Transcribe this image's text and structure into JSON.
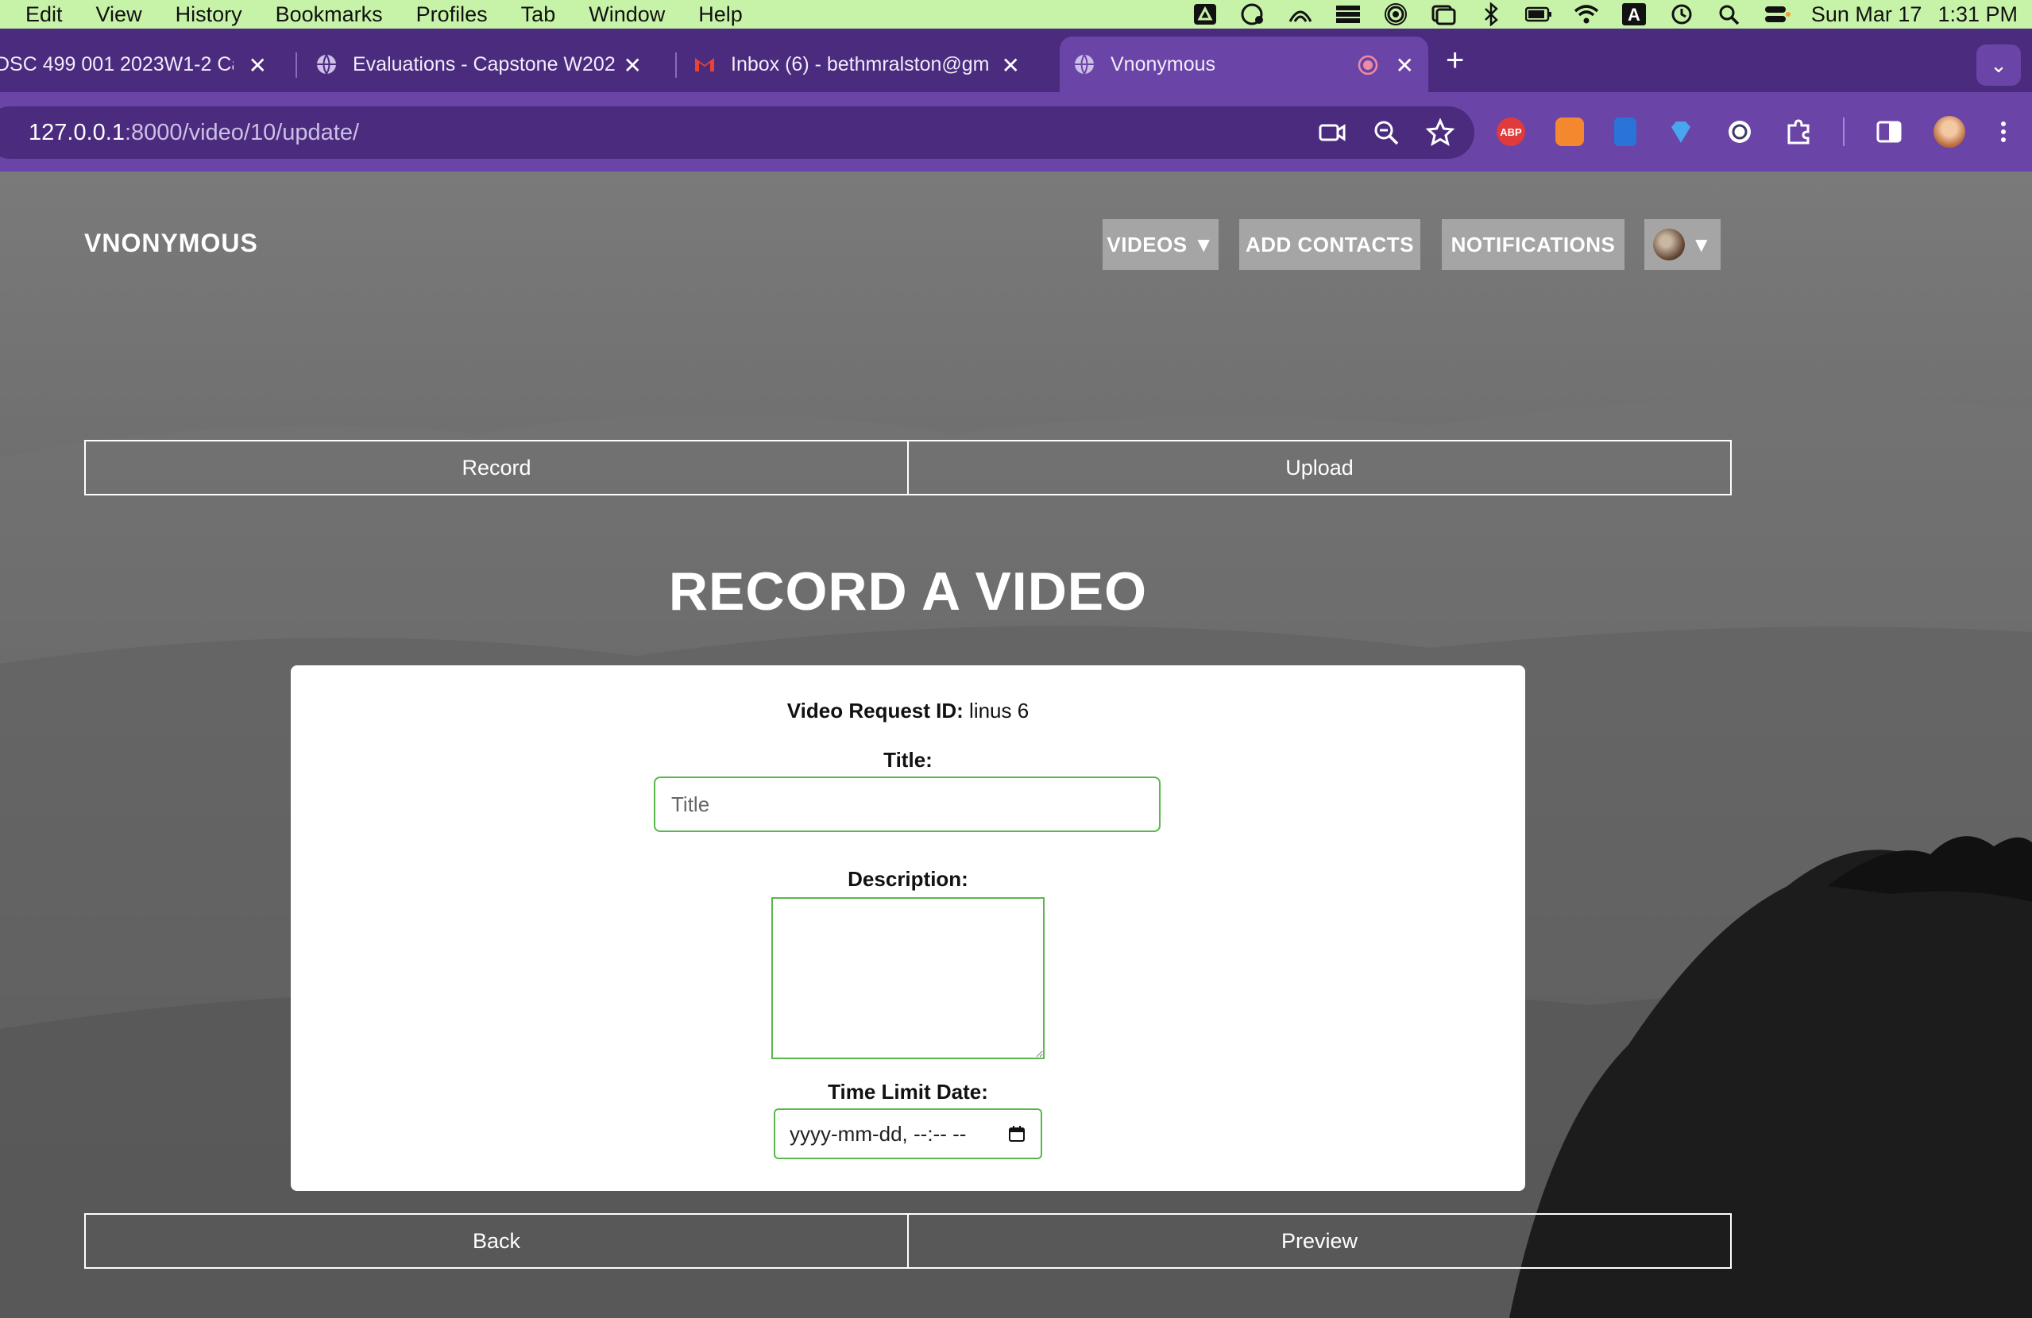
{
  "menubar": {
    "menus": [
      "Edit",
      "View",
      "History",
      "Bookmarks",
      "Profiles",
      "Tab",
      "Window",
      "Help"
    ],
    "status_icons": [
      "google-drive-icon",
      "grammarly-icon",
      "cloud-icon",
      "menu-grid-icon",
      "airdrop-icon",
      "window-icon",
      "bluetooth-icon",
      "battery-icon",
      "wifi-icon",
      "keyboard-a-icon",
      "time-machine-icon",
      "search-icon",
      "control-center-icon"
    ],
    "keyboard_letter": "A",
    "date": "Sun Mar 17",
    "time": "1:31 PM"
  },
  "browser": {
    "tabs": [
      {
        "title": "DSC 499 001 2023W1-2 Ca",
        "active": false
      },
      {
        "title": "Evaluations - Capstone W202",
        "active": false
      },
      {
        "title": "Inbox (6) - bethmralston@gm",
        "active": false
      },
      {
        "title": "Vnonymous",
        "active": true
      }
    ],
    "new_tab": "+",
    "tab_menu": "⌄",
    "url_host": "127.0.0.1",
    "url_rest": ":8000/video/10/update/",
    "extensions": [
      "adblock-icon",
      "metamask-icon",
      "bitwarden-icon",
      "gem-icon",
      "grammarly-icon",
      "puzzle-icon"
    ],
    "adblock_label": "ABP"
  },
  "site": {
    "brand": "VNONYMOUS",
    "nav": {
      "videos": "VIDEOS ▼",
      "add_contacts": "ADD CONTACTS",
      "notifications": "NOTIFICATIONS",
      "profile_caret": "▼"
    },
    "mode_tabs": {
      "record": "Record",
      "upload": "Upload"
    },
    "heading": "RECORD A VIDEO",
    "form": {
      "request_id_label": "Video Request ID:",
      "request_id_value": "linus 6",
      "title_label": "Title:",
      "title_placeholder": "Title",
      "title_value": "",
      "description_label": "Description:",
      "description_value": "",
      "time_limit_label": "Time Limit Date:",
      "time_limit_placeholder": "yyyy-mm-dd, --:-- --"
    },
    "footer_buttons": {
      "back": "Back",
      "preview": "Preview"
    }
  }
}
